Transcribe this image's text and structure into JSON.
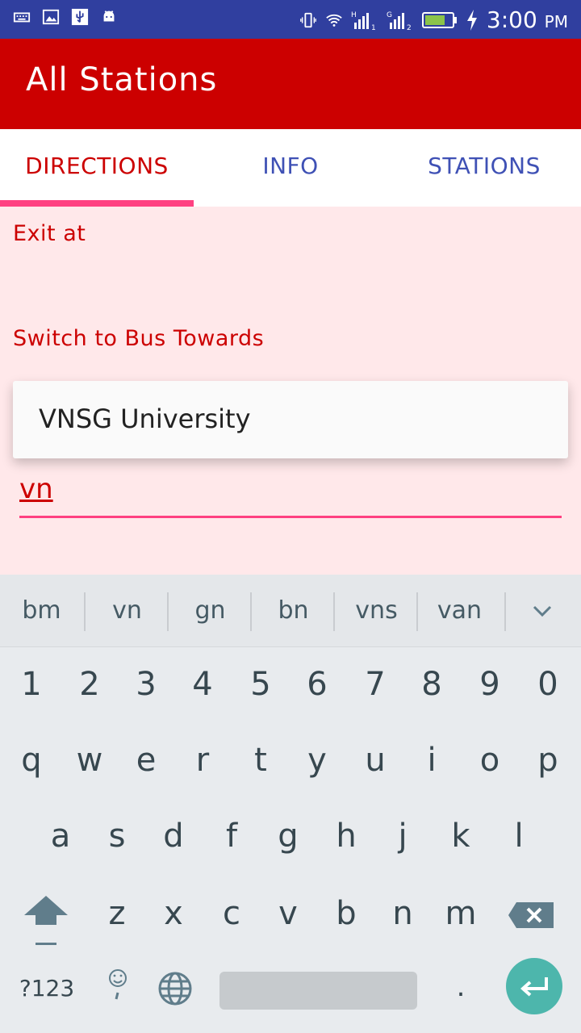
{
  "status_bar": {
    "time": "3:00",
    "ampm": "PM",
    "left_icons": [
      "keyboard-icon",
      "image-icon",
      "usb-icon",
      "android-icon"
    ],
    "right_icons": [
      "vibrate-icon",
      "wifi-icon",
      "signal-sim1-icon",
      "signal-sim2-icon",
      "battery-icon",
      "charging-icon"
    ],
    "sim1_label": "H",
    "sim2_label": "G"
  },
  "app_bar": {
    "title": "All Stations"
  },
  "tabs": [
    {
      "label": "DIRECTIONS",
      "active": true
    },
    {
      "label": "INFO",
      "active": false
    },
    {
      "label": "STATIONS",
      "active": false
    }
  ],
  "content": {
    "exit_label": "Exit at",
    "switch_label": "Switch to Bus Towards",
    "suggestion": "VNSG University",
    "input_value": "vn"
  },
  "keyboard": {
    "suggestions": [
      "bm",
      "vn",
      "gn",
      "bn",
      "vns",
      "van"
    ],
    "numbers": [
      "1",
      "2",
      "3",
      "4",
      "5",
      "6",
      "7",
      "8",
      "9",
      "0"
    ],
    "row1": [
      "q",
      "w",
      "e",
      "r",
      "t",
      "y",
      "u",
      "i",
      "o",
      "p"
    ],
    "row2": [
      "a",
      "s",
      "d",
      "f",
      "g",
      "h",
      "j",
      "k",
      "l"
    ],
    "row3": [
      "z",
      "x",
      "c",
      "v",
      "b",
      "n",
      "m"
    ],
    "symbols_label": "?123",
    "period_label": ".",
    "colors": {
      "enter": "#4db6ac",
      "accent": "#ff4081",
      "app_bar": "#cc0000",
      "status_bar": "#303f9f"
    }
  }
}
